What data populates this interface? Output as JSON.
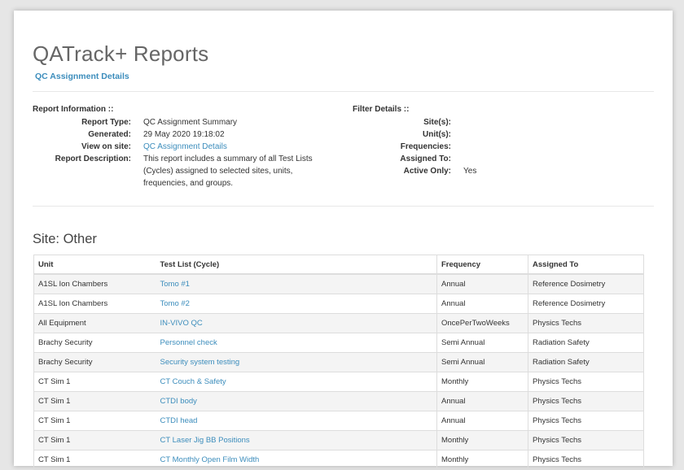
{
  "header": {
    "title": "QATrack+ Reports",
    "subtitle_link": "QC Assignment Details"
  },
  "report_info": {
    "heading": "Report Information ::",
    "rows": [
      {
        "label": "Report Type:",
        "value": "QC Assignment Summary"
      },
      {
        "label": "Generated:",
        "value": "29 May 2020 19:18:02"
      },
      {
        "label": "View on site:",
        "value": "QC Assignment Details"
      },
      {
        "label": "Report Description:",
        "value": "This report includes a summary of all Test Lists (Cycles) assigned to selected sites, units, frequencies, and groups."
      }
    ]
  },
  "filter_details": {
    "heading": "Filter Details ::",
    "rows": [
      {
        "label": "Site(s):",
        "value": ""
      },
      {
        "label": "Unit(s):",
        "value": ""
      },
      {
        "label": "Frequencies:",
        "value": ""
      },
      {
        "label": "Assigned To:",
        "value": ""
      },
      {
        "label": "Active Only:",
        "value": "Yes"
      }
    ]
  },
  "site_section": {
    "heading": "Site: Other",
    "columns": [
      "Unit",
      "Test List (Cycle)",
      "Frequency",
      "Assigned To"
    ],
    "rows": [
      {
        "unit": "A1SL Ion Chambers",
        "test_list": "Tomo #1",
        "frequency": "Annual",
        "assigned_to": "Reference Dosimetry"
      },
      {
        "unit": "A1SL Ion Chambers",
        "test_list": "Tomo #2",
        "frequency": "Annual",
        "assigned_to": "Reference Dosimetry"
      },
      {
        "unit": "All Equipment",
        "test_list": "IN-VIVO QC",
        "frequency": "OncePerTwoWeeks",
        "assigned_to": "Physics Techs"
      },
      {
        "unit": "Brachy Security",
        "test_list": "Personnel check",
        "frequency": "Semi Annual",
        "assigned_to": "Radiation Safety"
      },
      {
        "unit": "Brachy Security",
        "test_list": "Security system testing",
        "frequency": "Semi Annual",
        "assigned_to": "Radiation Safety"
      },
      {
        "unit": "CT Sim 1",
        "test_list": "CT Couch & Safety",
        "frequency": "Monthly",
        "assigned_to": "Physics Techs"
      },
      {
        "unit": "CT Sim 1",
        "test_list": "CTDI body",
        "frequency": "Annual",
        "assigned_to": "Physics Techs"
      },
      {
        "unit": "CT Sim 1",
        "test_list": "CTDI head",
        "frequency": "Annual",
        "assigned_to": "Physics Techs"
      },
      {
        "unit": "CT Sim 1",
        "test_list": "CT Laser Jig BB Positions",
        "frequency": "Monthly",
        "assigned_to": "Physics Techs"
      },
      {
        "unit": "CT Sim 1",
        "test_list": "CT Monthly Open Film Width",
        "frequency": "Monthly",
        "assigned_to": "Physics Techs"
      }
    ]
  }
}
